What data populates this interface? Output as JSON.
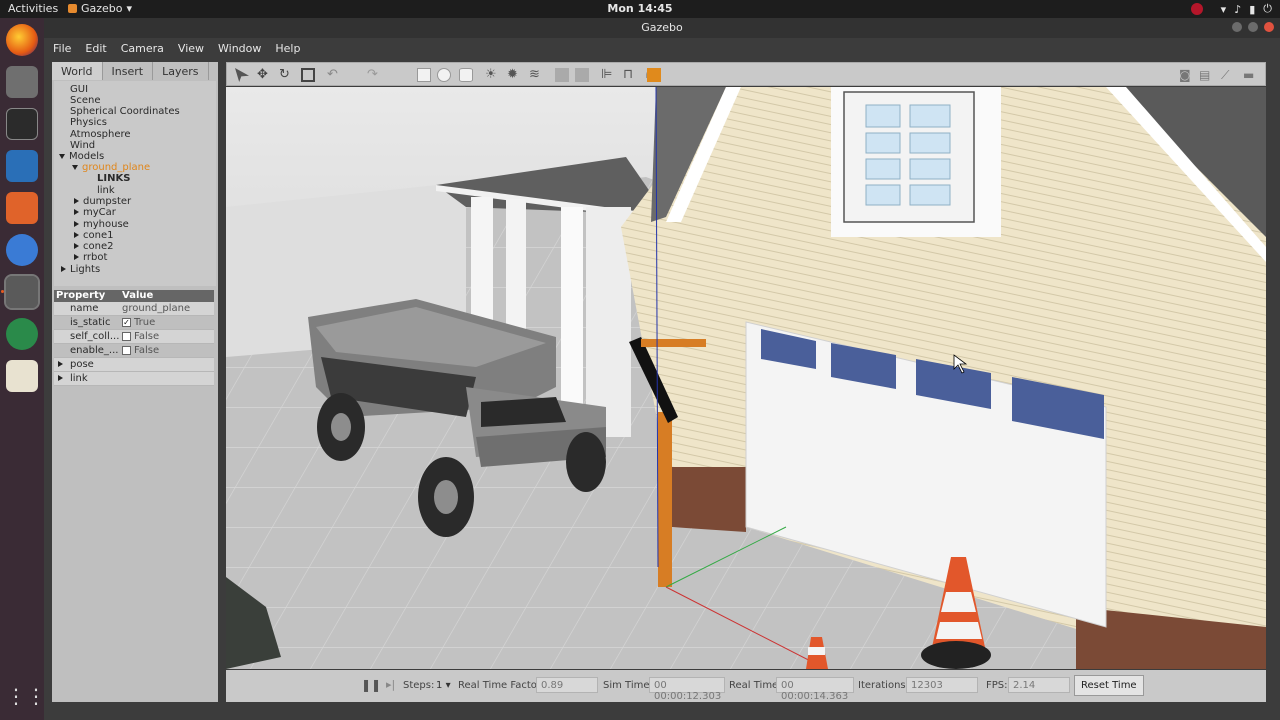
{
  "topbar": {
    "activities": "Activities",
    "app": "Gazebo",
    "clock": "Mon 14:45"
  },
  "window": {
    "title": "Gazebo"
  },
  "menu": [
    "File",
    "Edit",
    "Camera",
    "View",
    "Window",
    "Help"
  ],
  "tabs": [
    "World",
    "Insert",
    "Layers"
  ],
  "tree": {
    "gui": "GUI",
    "scene": "Scene",
    "spherical": "Spherical Coordinates",
    "physics": "Physics",
    "atmosphere": "Atmosphere",
    "wind": "Wind",
    "models": "Models",
    "ground_plane": "ground_plane",
    "links": "LINKS",
    "link": "link",
    "dumpster": "dumpster",
    "mycar": "myCar",
    "myhouse": "myhouse",
    "cone1": "cone1",
    "cone2": "cone2",
    "rrbot": "rrbot",
    "lights": "Lights"
  },
  "properties": {
    "header_property": "Property",
    "header_value": "Value",
    "name_label": "name",
    "name_value": "ground_plane",
    "is_static_label": "is_static",
    "is_static_value": "True",
    "self_coll_label": "self_coll...",
    "self_coll_value": "False",
    "enable_label": "enable_...",
    "enable_value": "False",
    "pose_label": "pose",
    "link_label": "link"
  },
  "bottom": {
    "steps_label": "Steps:",
    "steps_value": "1",
    "rtf_label": "Real Time Factor:",
    "rtf_value": "0.89",
    "sim_label": "Sim Time:",
    "sim_value": "00 00:00:12.303",
    "real_label": "Real Time:",
    "real_value": "00 00:00:14.363",
    "iter_label": "Iterations:",
    "iter_value": "12303",
    "fps_label": "FPS:",
    "fps_value": "2.14",
    "reset_label": "Reset Time"
  },
  "colors": {
    "accent": "#e0861b",
    "dock": "#3a2b35",
    "panel": "#bfbfbf"
  }
}
